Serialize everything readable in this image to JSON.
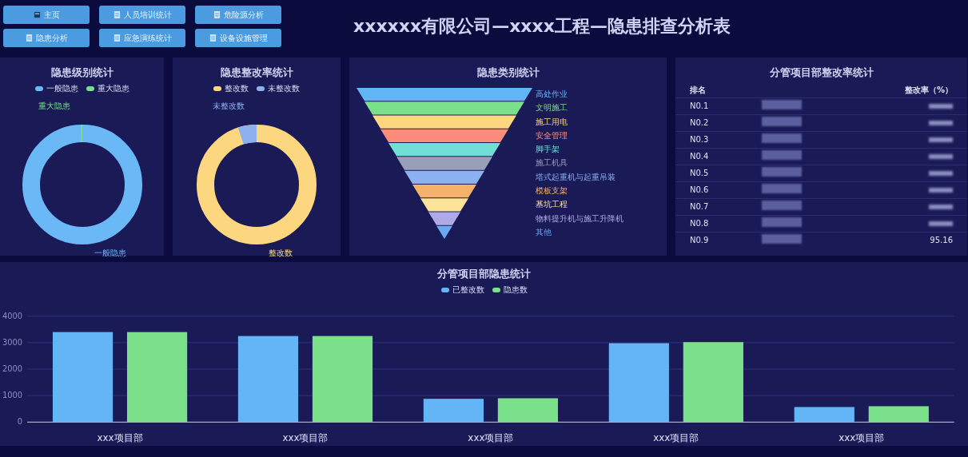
{
  "nav": [
    {
      "label": "主页",
      "kind": "home"
    },
    {
      "label": "人员培训统计",
      "kind": "doc"
    },
    {
      "label": "危险源分析",
      "kind": "doc"
    },
    {
      "label": "隐患分析",
      "kind": "doc"
    },
    {
      "label": "应急演练统计",
      "kind": "doc"
    },
    {
      "label": "设备设施管理",
      "kind": "doc"
    }
  ],
  "title": "xxxxxx有限公司—xxxx工程—隐患排查分析表",
  "level_panel": {
    "title": "隐患级别统计",
    "legend": [
      {
        "label": "一般隐患",
        "color": "#6ab8f5"
      },
      {
        "label": "重大隐患",
        "color": "#7adf8c"
      }
    ],
    "top_label": "重大隐患",
    "bottom_label": "一般隐患"
  },
  "rate_panel": {
    "title": "隐患整改率统计",
    "legend": [
      {
        "label": "整改数",
        "color": "#fcd77f"
      },
      {
        "label": "未整改数",
        "color": "#8cb0f0"
      }
    ],
    "top_label": "未整改数",
    "bottom_label": "整改数"
  },
  "category_panel": {
    "title": "隐患类别统计",
    "items": [
      {
        "label": "高处作业",
        "color": "#62b6f5"
      },
      {
        "label": "文明施工",
        "color": "#7ae08a"
      },
      {
        "label": "施工用电",
        "color": "#fcd77f"
      },
      {
        "label": "安全管理",
        "color": "#fa8c7c"
      },
      {
        "label": "脚手架",
        "color": "#72dfd6"
      },
      {
        "label": "施工机具",
        "color": "#9a9fb8"
      },
      {
        "label": "塔式起重机与起重吊装",
        "color": "#8cb0f0"
      },
      {
        "label": "模板支架",
        "color": "#f5b26a"
      },
      {
        "label": "基坑工程",
        "color": "#fce39a"
      },
      {
        "label": "物料提升机与施工升降机",
        "color": "#b0a9e8"
      },
      {
        "label": "其他",
        "color": "#6aa8f0"
      }
    ]
  },
  "table_panel": {
    "title": "分管项目部整改率统计",
    "columns": [
      "排名",
      "整改率（%）"
    ],
    "rows": [
      {
        "rank": "N0.1"
      },
      {
        "rank": "N0.2"
      },
      {
        "rank": "N0.3"
      },
      {
        "rank": "N0.4"
      },
      {
        "rank": "N0.5"
      },
      {
        "rank": "N0.6"
      },
      {
        "rank": "N0.7"
      },
      {
        "rank": "N0.8"
      },
      {
        "rank": "N0.9",
        "rate": "95.16"
      }
    ]
  },
  "bar_panel": {
    "chart_data": {
      "type": "bar",
      "title": "分管项目部隐患统计",
      "categories": [
        "xxx项目部",
        "xxx项目部",
        "xxx项目部",
        "xxx项目部",
        "xxx项目部"
      ],
      "series": [
        {
          "name": "已整改数",
          "color": "#64b5f6",
          "values": [
            3400,
            3250,
            880,
            2980,
            570
          ]
        },
        {
          "name": "隐患数",
          "color": "#7ae08a",
          "values": [
            3400,
            3250,
            900,
            3020,
            600
          ]
        }
      ],
      "ylim": [
        0,
        4000
      ],
      "grid": true,
      "yticks": [
        0,
        1000,
        2000,
        3000,
        4000
      ]
    }
  }
}
